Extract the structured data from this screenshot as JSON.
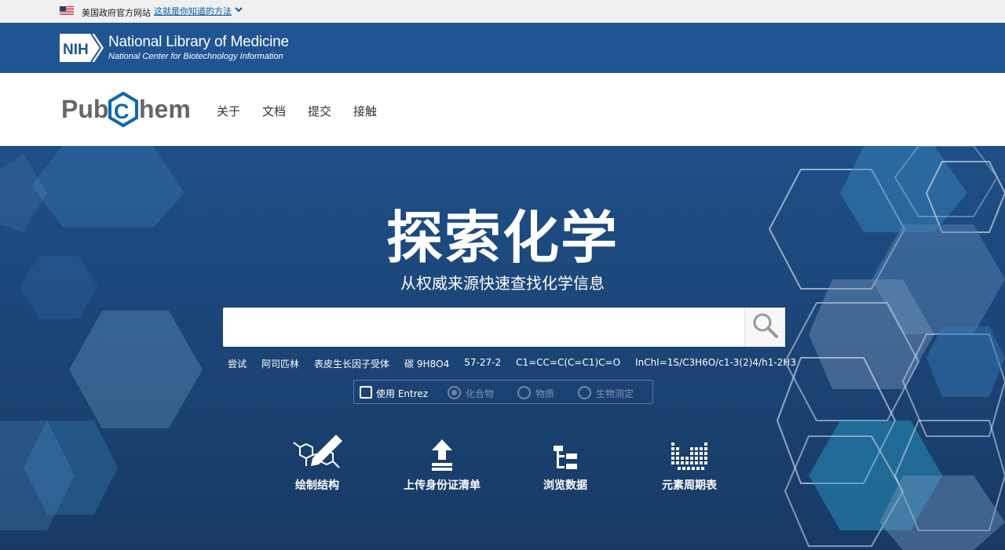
{
  "gov_banner": {
    "text": "美国政府官方网站",
    "link": "这就是你知道的方法"
  },
  "nih": {
    "logo_text": "NIH",
    "title": "National Library of Medicine",
    "subtitle": "National Center for Biotechnology Information"
  },
  "pubchem": {
    "logo_pub": "Pub",
    "logo_c": "C",
    "logo_hem": "hem",
    "nav": [
      {
        "label": "关于"
      },
      {
        "label": "文档"
      },
      {
        "label": "提交"
      },
      {
        "label": "接触"
      }
    ]
  },
  "hero": {
    "title": "探索化学",
    "subtitle": "从权威来源快速查找化学信息",
    "search_placeholder": "",
    "try_label": "尝试",
    "try_examples": [
      "阿司匹林",
      "表皮生长因子受体",
      "碳 9H8O4",
      "57-27-2",
      "C1=CC=C(C=C1)C=O",
      "InChI=1S/C3H6O/c1-3(2)4/h1-2H3"
    ],
    "entrez": {
      "checkbox_label": "使用 Entrez",
      "options": [
        "化合物",
        "物质",
        "生物测定"
      ],
      "selected": "化合物"
    },
    "actions": [
      {
        "label": "绘制结构",
        "icon": "draw-structure-icon"
      },
      {
        "label": "上传身份证清单",
        "icon": "upload-icon"
      },
      {
        "label": "浏览数据",
        "icon": "tree-icon"
      },
      {
        "label": "元素周期表",
        "icon": "periodic-table-icon"
      }
    ]
  },
  "colors": {
    "nih_blue": "#205493",
    "hero_blue": "#1c4577",
    "pubchem_blue": "#0d67b0"
  }
}
